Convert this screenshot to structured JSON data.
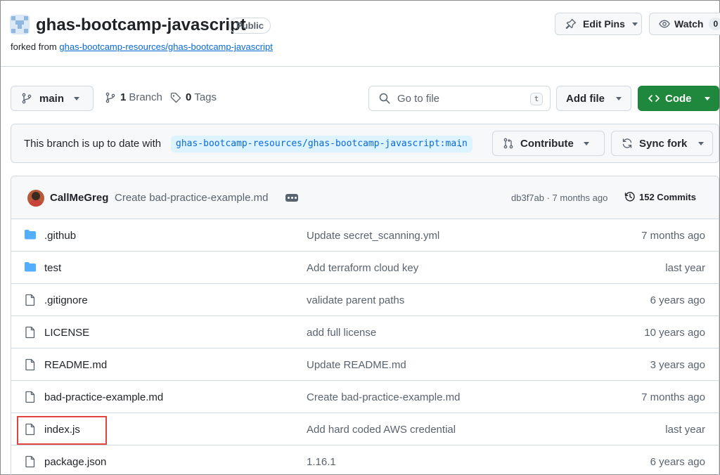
{
  "repo": {
    "name": "ghas-bootcamp-javascript",
    "visibility": "Public",
    "forked_prefix": "forked from",
    "forked_from": "ghas-bootcamp-resources/ghas-bootcamp-javascript"
  },
  "header_actions": {
    "edit_pins": "Edit Pins",
    "watch": "Watch",
    "watch_count": "0"
  },
  "toolbar": {
    "branch": "main",
    "branches_count": "1",
    "branches_label": "Branch",
    "tags_count": "0",
    "tags_label": "Tags",
    "search_placeholder": "Go to file",
    "search_shortcut": "t",
    "add_file": "Add file",
    "code": "Code"
  },
  "sync": {
    "text": "This branch is up to date with",
    "ref": "ghas-bootcamp-resources/ghas-bootcamp-javascript:main",
    "period": ".",
    "contribute": "Contribute",
    "sync_fork": "Sync fork"
  },
  "latest_commit": {
    "author": "CallMeGreg",
    "message": "Create bad-practice-example.md",
    "meta": "db3f7ab · 7 months ago",
    "commits_count": "152 Commits"
  },
  "files": [
    {
      "name": ".github",
      "type": "folder",
      "message": "Update secret_scanning.yml",
      "age": "7 months ago"
    },
    {
      "name": "test",
      "type": "folder",
      "message": "Add terraform cloud key",
      "age": "last year"
    },
    {
      "name": ".gitignore",
      "type": "file",
      "message": "validate parent paths",
      "age": "6 years ago"
    },
    {
      "name": "LICENSE",
      "type": "file",
      "message": "add full license",
      "age": "10 years ago"
    },
    {
      "name": "README.md",
      "type": "file",
      "message": "Update README.md",
      "age": "3 years ago"
    },
    {
      "name": "bad-practice-example.md",
      "type": "file",
      "message": "Create bad-practice-example.md",
      "age": "7 months ago"
    },
    {
      "name": "index.js",
      "type": "file",
      "message": "Add hard coded AWS credential",
      "age": "last year"
    },
    {
      "name": "package.json",
      "type": "file",
      "message": "1.16.1",
      "age": "6 years ago"
    }
  ],
  "colors": {
    "accent_link": "#0969da",
    "primary_button": "#1f883d",
    "folder_icon": "#54aeff",
    "highlight_box": "#e0443e"
  }
}
